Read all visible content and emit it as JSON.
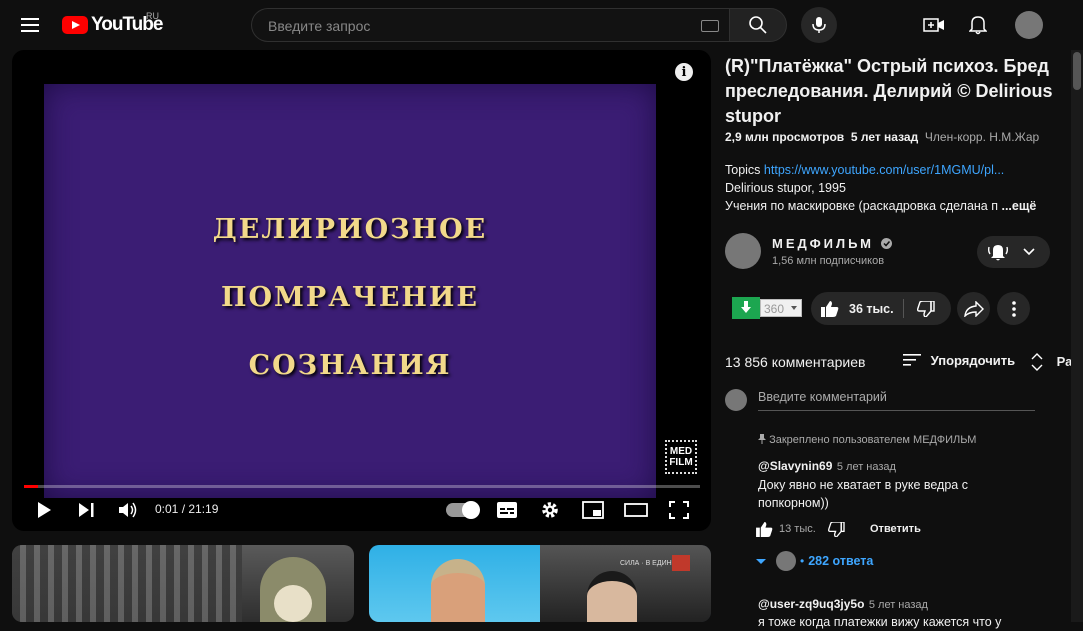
{
  "header": {
    "logo_text": "YouTube",
    "country_code": "RU",
    "search_placeholder": "Введите запрос"
  },
  "player": {
    "frame_lines": [
      "ДЕЛИРИОЗНОЕ",
      "ПОМРАЧЕНИЕ",
      "СОЗНАНИЯ"
    ],
    "watermark": [
      "MED",
      "FILM"
    ],
    "time_display": "0:01 / 21:19",
    "progress_fraction": 0.0008
  },
  "video": {
    "title": "(R)\"Платёжка\" Острый психоз. Бред преследования. Делирий © Delirious stupor",
    "views": "2,9 млн просмотров",
    "age": "5 лет назад",
    "author_credit": "Член-корр. Н.М.Жар",
    "description": {
      "topics_label": "Topics",
      "topics_link": "https://www.youtube.com/user/1MGMU/pl...",
      "line2": "Delirious stupor, 1995",
      "line3": "Учения по маскировке (раскадровка сделана п",
      "more": "...ещё"
    }
  },
  "channel": {
    "name": "МЕДФИЛЬМ",
    "subscribers": "1,56 млн подписчиков"
  },
  "actions": {
    "download_quality": "360",
    "likes": "36 тыс."
  },
  "comments": {
    "count": "13 856 комментариев",
    "sort_label": "Упорядочить",
    "extra_label": "Ра",
    "input_placeholder": "Введите комментарий",
    "items": [
      {
        "pinned": "Закреплено пользователем МЕДФИЛЬМ",
        "author": "@Slavynin69",
        "time": "5 лет назад",
        "text": [
          "Доку явно не хватает в руке ведра с",
          "попкорном))"
        ],
        "likes": "13 тыс.",
        "reply_label": "Ответить",
        "replies": "282 ответа"
      },
      {
        "author": "@user-zq9uq3jy5o",
        "time": "5 лет назад",
        "text": [
          "я тоже когда платежки вижу кажется что у"
        ]
      }
    ]
  },
  "thumbnails": {
    "second_ticker": "СИЛА · В ЕДИНСТВЕ"
  },
  "colors": {
    "background": "#0f0f0f",
    "brand_red": "#ff0000",
    "link_blue": "#3ea6ff",
    "frame_purple": "#3b1d74",
    "frame_text": "#f2d98a"
  }
}
